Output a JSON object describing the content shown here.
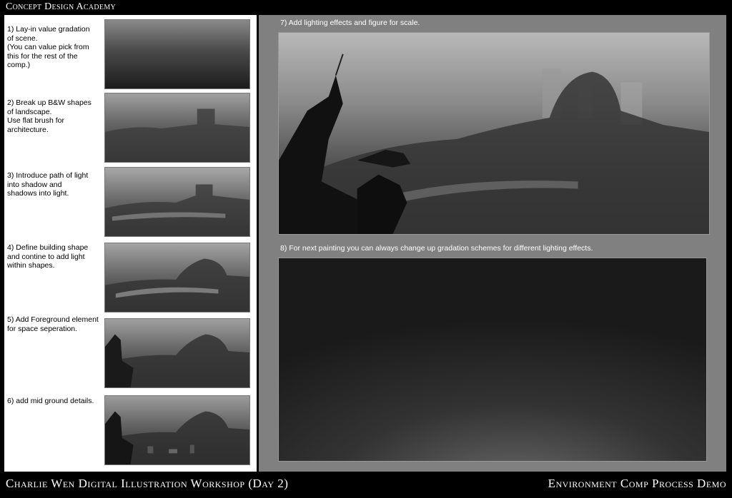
{
  "header": {
    "title": "Concept Design Academy"
  },
  "steps": [
    {
      "number": "1)",
      "text": "Lay-in value gradation\nof scene.\n(You can value pick from\nthis for the rest of the\ncomp.)"
    },
    {
      "number": "2)",
      "text": "Break up B&W shapes\nof landscape.\nUse flat brush for\narchitecture."
    },
    {
      "number": "3)",
      "text": "Introduce path of light\ninto shadow and\nshadows into light."
    },
    {
      "number": "4)",
      "text": "Define building shape\nand contine to add light\nwithin shapes."
    },
    {
      "number": "5)",
      "text": "Add Foreground element\nfor space seperation."
    },
    {
      "number": "6)",
      "text": "add mid ground details."
    }
  ],
  "main": {
    "step7_caption": "7) Add lighting effects and figure for scale.",
    "step8_caption": "8) For next painting you can always change up gradation schemes for different lighting effects."
  },
  "footer": {
    "left": "Charlie Wen Digital Illustration Workshop (Day 2)",
    "right": "Environment Comp Process Demo"
  }
}
